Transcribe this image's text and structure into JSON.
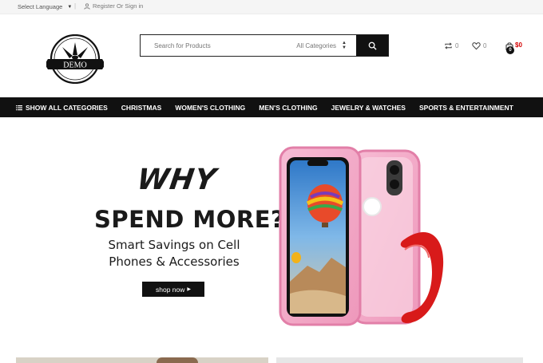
{
  "topbar": {
    "language_label": "Select Language",
    "login_label": "Register Or Sign in"
  },
  "header": {
    "logo_text": "DEMO",
    "search": {
      "placeholder": "Search for Products",
      "category_label": "All Categories"
    },
    "compare_count": "0",
    "wishlist_count": "0",
    "cart_count": "0",
    "cart_total": "$0"
  },
  "nav": {
    "items": [
      {
        "label": "SHOW ALL CATEGORIES"
      },
      {
        "label": "CHRISTMAS"
      },
      {
        "label": "WOMEN'S CLOTHING"
      },
      {
        "label": "MEN'S CLOTHING"
      },
      {
        "label": "JEWELRY & WATCHES"
      },
      {
        "label": "SPORTS & ENTERTAINMENT"
      }
    ]
  },
  "hero": {
    "headline_script": "WHY",
    "headline": "SPEND MORE?",
    "subline_1": "Smart Savings on Cell",
    "subline_2": "Phones & Accessories",
    "cta_label": "shop now"
  },
  "colors": {
    "accent_red": "#d40000",
    "nav_bg": "#111111",
    "case_pink": "#f2a9c6",
    "ring_red": "#d81a1a"
  }
}
